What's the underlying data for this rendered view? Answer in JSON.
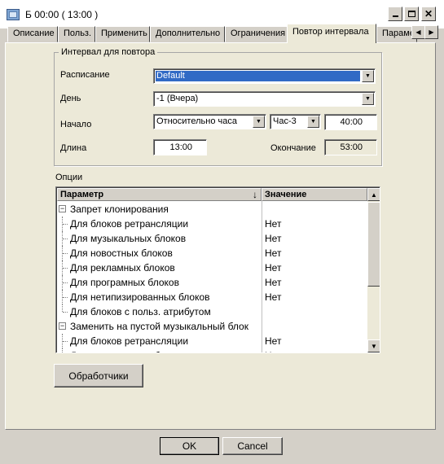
{
  "window": {
    "title": "Б 00:00 ( 13:00 )"
  },
  "tabs": [
    "Описание",
    "Польз.",
    "Применить",
    "Дополнительно",
    "Ограничения",
    "Повтор интервала",
    "Параме"
  ],
  "active_tab": "Повтор интервала",
  "interval_group": {
    "title": "Интервал для повтора",
    "schedule": {
      "label": "Расписание",
      "value": "Default"
    },
    "day": {
      "label": "День",
      "value": "-1 (Вчера)"
    },
    "start": {
      "label": "Начало",
      "mode": "Относительно часа",
      "hour": "Час-3",
      "time": "40:00"
    },
    "length": {
      "label": "Длина",
      "value": "13:00"
    },
    "end": {
      "label": "Окончание",
      "value": "53:00"
    }
  },
  "options": {
    "label": "Опции",
    "columns": {
      "param": "Параметр",
      "value": "Значение"
    },
    "rows": [
      {
        "param": "Запрет клонирования",
        "value": "",
        "group": true,
        "expanded": true
      },
      {
        "param": "Для блоков ретрансляции",
        "value": "Нет"
      },
      {
        "param": "Для музыкальных блоков",
        "value": "Нет"
      },
      {
        "param": "Для новостных блоков",
        "value": "Нет"
      },
      {
        "param": "Для рекламных блоков",
        "value": "Нет"
      },
      {
        "param": "Для програмных блоков",
        "value": "Нет"
      },
      {
        "param": "Для нетипизированных блоков",
        "value": "Нет"
      },
      {
        "param": "Для блоков с польз. атрибутом",
        "value": ""
      },
      {
        "param": "Заменить на пустой музыкальный блок",
        "value": "",
        "group": true,
        "expanded": true
      },
      {
        "param": "Для блоков ретрансляции",
        "value": "Нет"
      },
      {
        "param": "Для музыкальных блоков",
        "value": "Нет"
      }
    ]
  },
  "handlers_button": "Обработчики",
  "ok_button": "OK",
  "cancel_button": "Cancel",
  "colors": {
    "selection": "#316ac5",
    "face": "#d4d0c8",
    "panel": "#ece9d8"
  }
}
